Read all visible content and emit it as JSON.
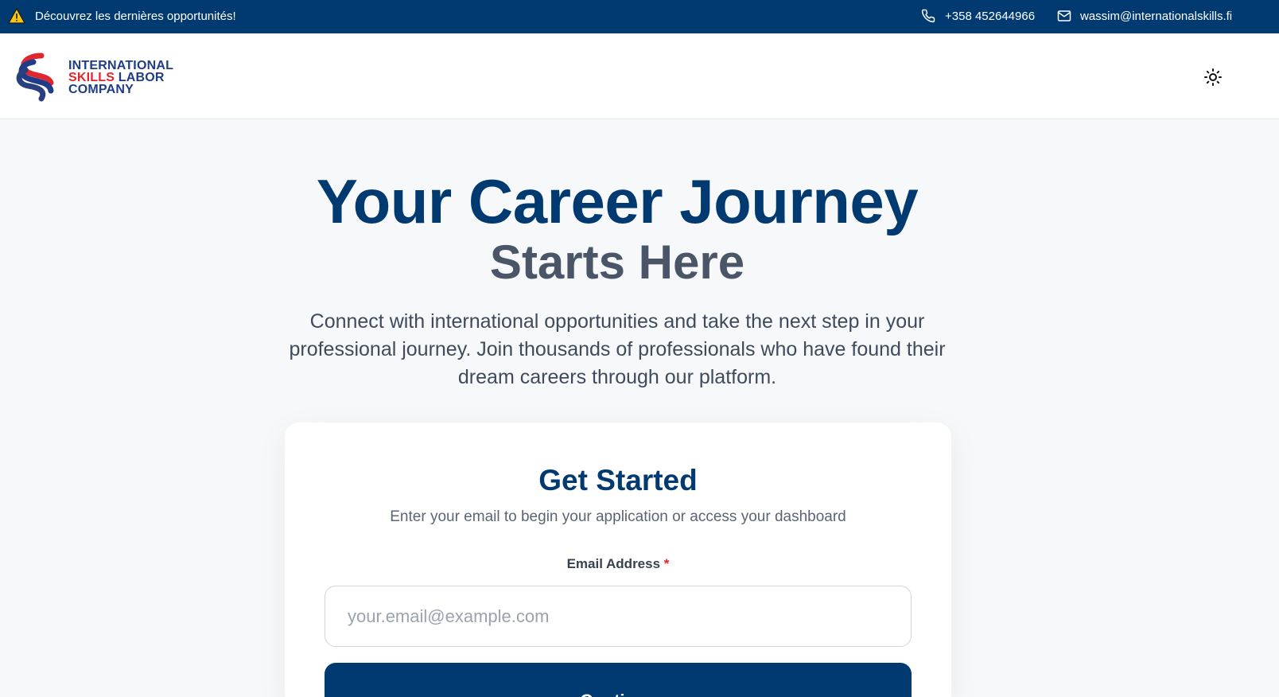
{
  "topbar": {
    "announcement": "Découvrez les dernières opportunités!",
    "phone": "+358 452644966",
    "email": "wassim@internationalskills.fi"
  },
  "header": {
    "logo_line1": "INTERNATIONAL",
    "logo_line2a": "SKILLS",
    "logo_line2b": "LABOR",
    "logo_line3": "COMPANY"
  },
  "hero": {
    "title": "Your Career Journey",
    "subtitle": "Starts Here",
    "description": "Connect with international opportunities and take the next step in your professional journey. Join thousands of professionals who have found their dream careers through our platform."
  },
  "form": {
    "title": "Get Started",
    "description": "Enter your email to begin your application or access your dashboard",
    "email_label": "Email Address",
    "required_mark": "*",
    "email_placeholder": "your.email@example.com",
    "email_value": "",
    "continue_label": "Continue"
  },
  "colors": {
    "brand_navy": "#003a70",
    "brand_red": "#e0262e",
    "brand_blue": "#1f3c88",
    "background": "#f6f8fa"
  }
}
